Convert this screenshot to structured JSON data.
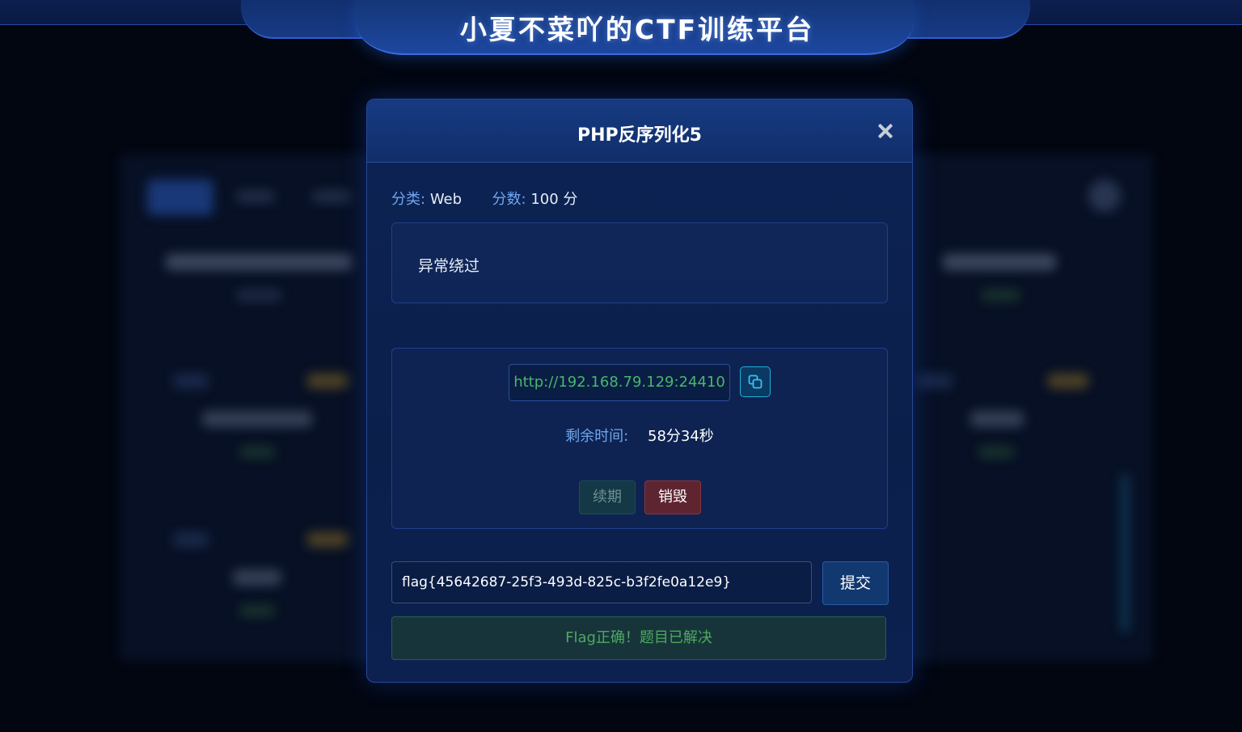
{
  "site": {
    "title": "小夏不菜吖的CTF训练平台"
  },
  "modal": {
    "title": "PHP反序列化5",
    "category_label": "分类:",
    "category_value": "Web",
    "score_label": "分数:",
    "score_value": "100 分",
    "description": "异常绕过"
  },
  "instance": {
    "url": "http://192.168.79.129:24410",
    "timer_label": "剩余时间:",
    "timer_value": "58分34秒",
    "renew_label": "续期",
    "destroy_label": "销毁"
  },
  "flag_form": {
    "input_value": "flag{45642687-25f3-493d-825c-b3f2fe0a12e9}",
    "submit_label": "提交",
    "result_message": "Flag正确！题目已解决"
  },
  "icons": {
    "close": "close-icon",
    "copy": "copy-icon"
  },
  "colors": {
    "accent_blue": "#6fa6f0",
    "url_green": "#47b86a",
    "success_green": "#4caa5d",
    "destroy_red": "#5e2530",
    "copy_cyan": "#1fb0d8"
  }
}
